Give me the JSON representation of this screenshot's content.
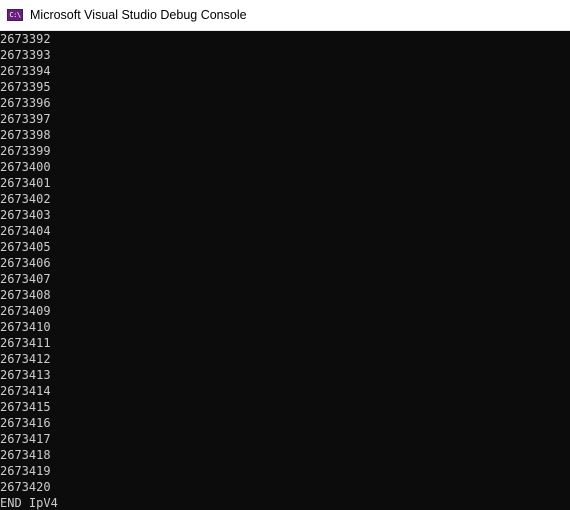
{
  "window": {
    "title": "Microsoft Visual Studio Debug Console",
    "icon": "console-app-icon",
    "icon_text": "C:\\",
    "colors": {
      "titlebar_bg": "#ffffff",
      "console_bg": "#0c0c0c",
      "console_text": "#cccccc",
      "icon_bg": "#68217a"
    }
  },
  "console": {
    "lines": [
      "2673392",
      "2673393",
      "2673394",
      "2673395",
      "2673396",
      "2673397",
      "2673398",
      "2673399",
      "2673400",
      "2673401",
      "2673402",
      "2673403",
      "2673404",
      "2673405",
      "2673406",
      "2673407",
      "2673408",
      "2673409",
      "2673410",
      "2673411",
      "2673412",
      "2673413",
      "2673414",
      "2673415",
      "2673416",
      "2673417",
      "2673418",
      "2673419",
      "2673420",
      "END IpV4"
    ]
  }
}
